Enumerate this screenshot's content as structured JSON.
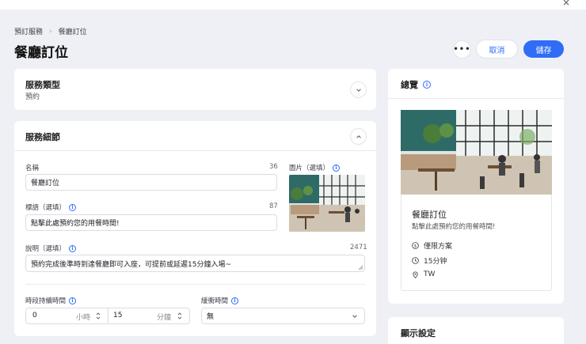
{
  "breadcrumb": {
    "parent": "預訂服務",
    "current": "餐廳訂位"
  },
  "page_title": "餐廳訂位",
  "header_actions": {
    "more": "•••",
    "cancel": "取消",
    "save": "儲存"
  },
  "service_type": {
    "title": "服務類型",
    "value": "預約"
  },
  "service_detail": {
    "title": "服務細節",
    "name": {
      "label": "名稱",
      "count": "36",
      "value": "餐廳訂位"
    },
    "image": {
      "label": "圖片（選填）"
    },
    "tagline": {
      "label": "標語（選填）",
      "count": "87",
      "value": "點擊此處預約您的用餐時間!"
    },
    "description": {
      "label": "說明（選填）",
      "count": "2471",
      "value": "預約完成後準時到達餐廳即可入座，可提前或延遲15分鐘入場~"
    },
    "duration": {
      "label": "時段持續時間",
      "hours": "0",
      "hours_unit": "小時",
      "minutes": "15",
      "minutes_unit": "分鐘"
    },
    "buffer": {
      "label": "緩衝時間",
      "value": "無"
    }
  },
  "overview": {
    "title": "總覽",
    "name": "餐廳訂位",
    "tagline": "點擊此處預約您的用餐時間!",
    "price": "僅限方案",
    "duration": "15分钟",
    "location": "TW"
  },
  "display_settings": {
    "title": "顯示設定"
  },
  "colors": {
    "accent": "#2f6df6",
    "background": "#eef0f5"
  }
}
